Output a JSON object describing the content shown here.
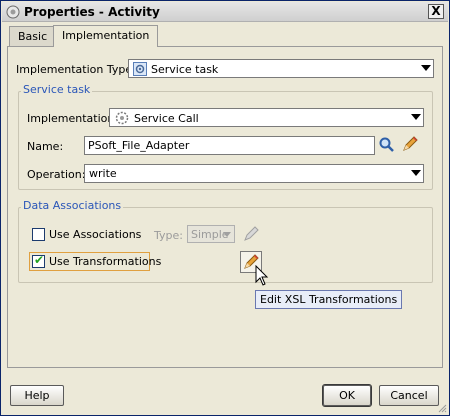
{
  "window": {
    "title": "Properties - Activity",
    "close_label": "X"
  },
  "tabs": [
    {
      "label": "Basic",
      "active": false
    },
    {
      "label": "Implementation",
      "active": true
    }
  ],
  "implementation_type": {
    "label": "Implementation Type:",
    "value": "Service task"
  },
  "service_task": {
    "group_title": "Service task",
    "implementation_label": "Implementation:",
    "implementation_value": "Service Call",
    "name_label": "Name:",
    "name_value": "PSoft_File_Adapter",
    "operation_label": "Operation:",
    "operation_value": "write"
  },
  "data_associations": {
    "group_title": "Data Associations",
    "use_associations_label": "Use Associations",
    "use_associations_checked": false,
    "type_label": "Type:",
    "type_value": "Simple",
    "use_transformations_label": "Use Transformations",
    "use_transformations_checked": true,
    "tooltip": "Edit XSL Transformations"
  },
  "buttons": {
    "help": "Help",
    "ok": "OK",
    "cancel": "Cancel"
  },
  "icons": {
    "title": "gear-app-icon",
    "search": "search-icon",
    "edit": "pencil-icon",
    "cursor": "arrow-cursor-icon"
  }
}
